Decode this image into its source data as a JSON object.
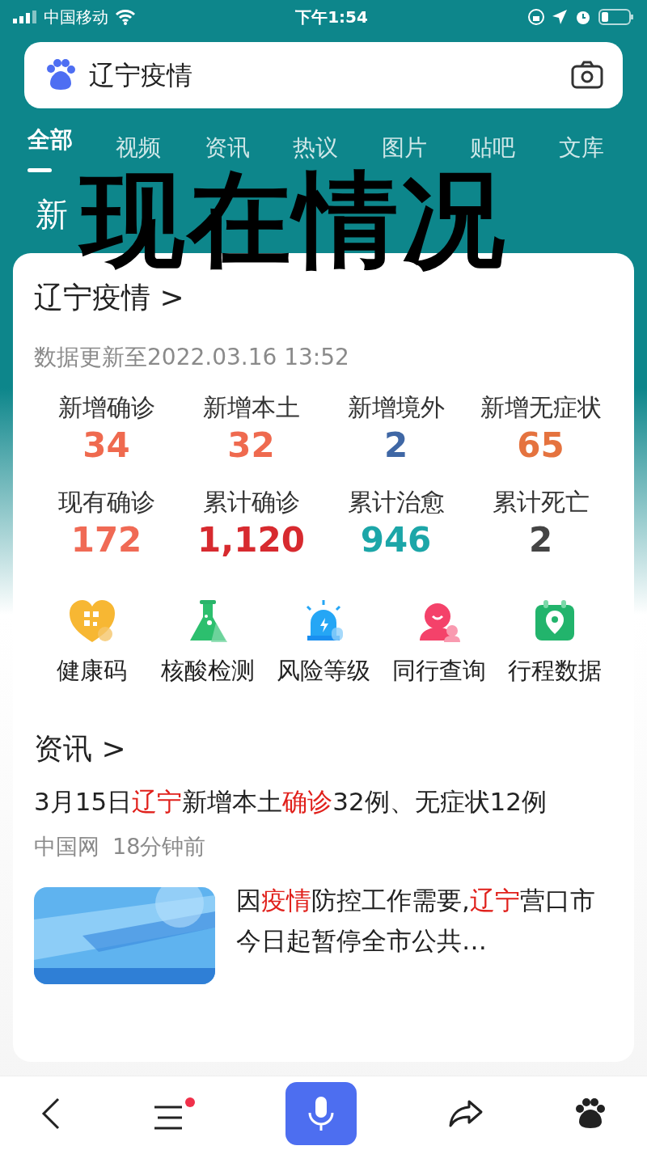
{
  "status_bar": {
    "carrier": "中国移动",
    "time": "下午1:54"
  },
  "search": {
    "value": "辽宁疫情"
  },
  "tabs": [
    {
      "label": "全部",
      "selected": true
    },
    {
      "label": "视频",
      "selected": false
    },
    {
      "label": "资讯",
      "selected": false
    },
    {
      "label": "热议",
      "selected": false
    },
    {
      "label": "图片",
      "selected": false
    },
    {
      "label": "贴吧",
      "selected": false
    },
    {
      "label": "文库",
      "selected": false
    }
  ],
  "banner": {
    "title_parts": [
      "新"
    ]
  },
  "caption_overlay": "现在情况",
  "epidemic_card": {
    "title": "辽宁疫情",
    "chevron": ">",
    "updated": "数据更新至2022.03.16 13:52",
    "stats": [
      {
        "label": "新增确诊",
        "value": "34",
        "color": "#ef6a4f"
      },
      {
        "label": "新增本土",
        "value": "32",
        "color": "#ef6a4f"
      },
      {
        "label": "新增境外",
        "value": "2",
        "color": "#3f67a5"
      },
      {
        "label": "新增无症状",
        "value": "65",
        "color": "#e5733f"
      },
      {
        "label": "现有确诊",
        "value": "172",
        "color": "#f06a55"
      },
      {
        "label": "累计确诊",
        "value": "1,120",
        "color": "#d72a2f"
      },
      {
        "label": "累计治愈",
        "value": "946",
        "color": "#1ca6a8"
      },
      {
        "label": "累计死亡",
        "value": "2",
        "color": "#444444"
      }
    ],
    "services": [
      {
        "kind": "health",
        "label": "健康码"
      },
      {
        "kind": "test",
        "label": "核酸检测"
      },
      {
        "kind": "risk",
        "label": "风险等级"
      },
      {
        "kind": "companion",
        "label": "同行查询"
      },
      {
        "kind": "trip",
        "label": "行程数据"
      }
    ]
  },
  "news": {
    "title": "资讯",
    "chevron": ">",
    "items": [
      {
        "title": [
          {
            "text": "3月15日",
            "highlight": false
          },
          {
            "text": "辽宁",
            "highlight": true
          },
          {
            "text": "新增本土",
            "highlight": false
          },
          {
            "text": "确诊",
            "highlight": true
          },
          {
            "text": "32例、无症状12例",
            "highlight": false
          }
        ],
        "source": "中国网",
        "time": "18分钟前"
      },
      {
        "kind": "picture",
        "title": [
          {
            "text": "因",
            "highlight": false
          },
          {
            "text": "疫情",
            "highlight": true
          },
          {
            "text": "防控工作需要,",
            "highlight": false
          },
          {
            "text": "辽宁",
            "highlight": true
          },
          {
            "text": "营口市今日起暂停全市公共…",
            "highlight": false
          }
        ]
      }
    ]
  },
  "bottom_bar": {
    "menu_badge": true
  }
}
